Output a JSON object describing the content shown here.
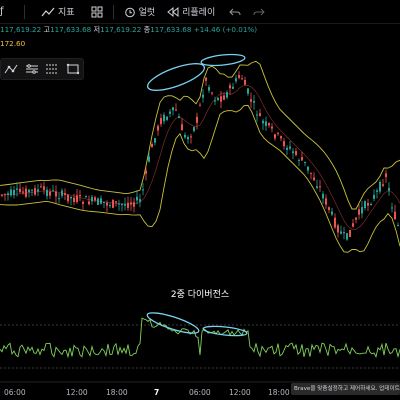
{
  "toolbar": {
    "fx_label": "ƒ",
    "indicators_label": "지표",
    "alert_label": "얼럿",
    "replay_label": "리플레이"
  },
  "ohlc": {
    "open_value": "117,619.22",
    "high_label": "고",
    "high_value": "117,633.68",
    "low_label": "저",
    "low_value": "117,619.22",
    "close_label": "종",
    "close_value": "117,633.68",
    "change": "+14.46 (+0.01%)"
  },
  "indicator_value": "172.60",
  "caption": "2중 다이버전스",
  "x_axis": {
    "labels": [
      "06:00",
      "12:00",
      "18:00",
      "7",
      "06:00",
      "12:00",
      "18:00"
    ]
  },
  "toast": "Brave을 맞춤설정하고 제어하세요. 업데이트",
  "colors": {
    "bollinger": "#c8c23a",
    "candle_up": "#26a69a",
    "candle_down": "#ef5350",
    "rsi_line": "#7fd35a",
    "highlight": "#7ad2f0"
  }
}
